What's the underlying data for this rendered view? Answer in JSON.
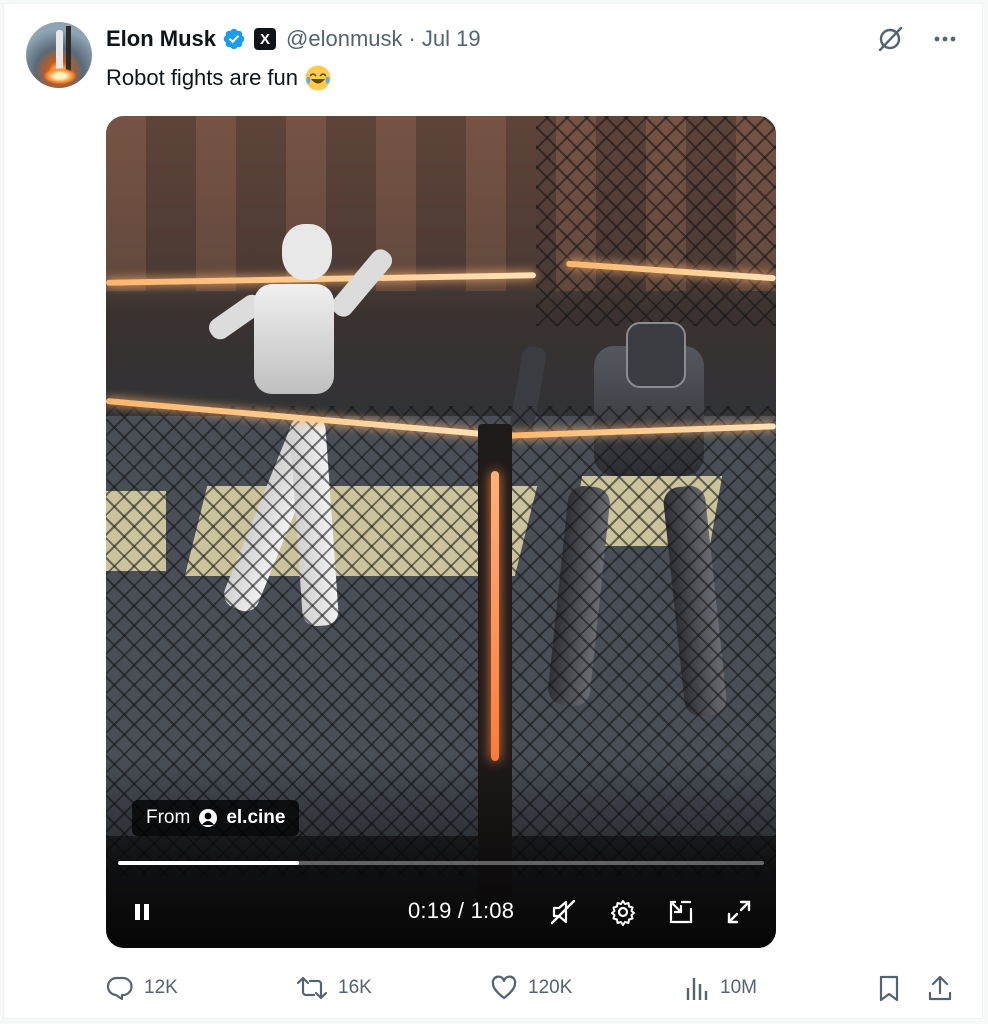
{
  "post": {
    "author_name": "Elon Musk",
    "handle": "@elonmusk",
    "separator": "·",
    "date": "Jul 19",
    "text": "Robot fights are fun",
    "emoji": "face-with-tears-of-joy",
    "x_badge": "X"
  },
  "video": {
    "from_label": "From",
    "from_handle": "el.cine",
    "time_current": "0:19",
    "time_separator": " / ",
    "time_total": "1:08",
    "progress_fraction": 0.28
  },
  "actions": {
    "replies": "12K",
    "reposts": "16K",
    "likes": "120K",
    "views": "10M"
  },
  "colors": {
    "accent": "#1d9bf0",
    "muted": "#536471",
    "text": "#0f1419"
  }
}
